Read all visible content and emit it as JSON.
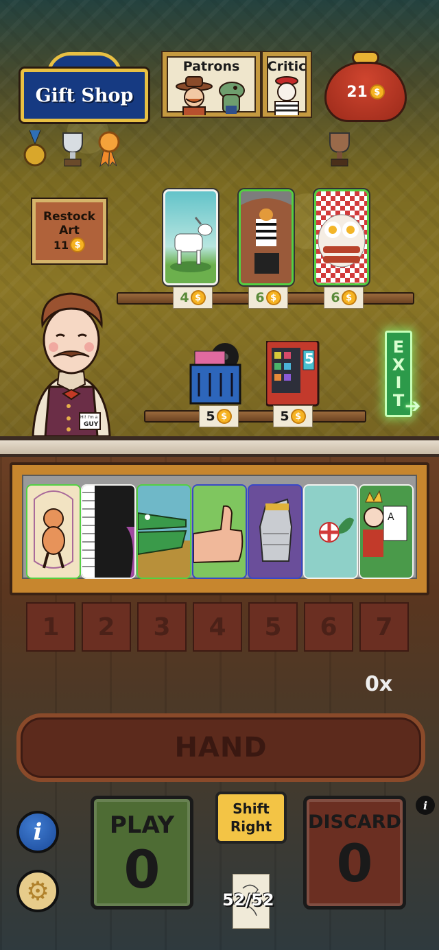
{
  "shop": {
    "sign": "Gift Shop",
    "patrons_label": "Patrons",
    "critic_label": "Critic",
    "coins": "21",
    "restock": {
      "line1": "Restock",
      "line2": "Art",
      "cost": "11"
    }
  },
  "awards": [
    "gold-medal",
    "silver-trophy",
    "orange-ribbon",
    "bronze-trophy"
  ],
  "art_shelf": [
    {
      "name": "goat-art",
      "price": "4",
      "border": "white"
    },
    {
      "name": "striped-dog-art",
      "price": "6",
      "border": "green"
    },
    {
      "name": "eggs-bacon-art",
      "price": "6",
      "border": "green"
    }
  ],
  "item_shelf": [
    {
      "name": "record-crate",
      "price": "5"
    },
    {
      "name": "vending-machine",
      "price": "5",
      "display": "5"
    }
  ],
  "exit": {
    "letters": [
      "E",
      "X",
      "I",
      "T"
    ]
  },
  "shopkeeper": {
    "badge_line1": "Hi! I'm a",
    "badge_line2": "GUY"
  },
  "hand_cards": [
    {
      "name": "jump-rope-cat",
      "border": "green"
    },
    {
      "name": "piano-keys",
      "border": "white"
    },
    {
      "name": "crocodile",
      "border": "green"
    },
    {
      "name": "thumbs-up",
      "border": "blue"
    },
    {
      "name": "armored-gauntlet",
      "border": "blue"
    },
    {
      "name": "peppermint",
      "border": "white"
    },
    {
      "name": "king-cards",
      "border": "white"
    }
  ],
  "slots": [
    "1",
    "2",
    "3",
    "4",
    "5",
    "6",
    "7"
  ],
  "multiplier": "0x",
  "hand_label": "HAND",
  "buttons": {
    "play": "PLAY",
    "play_count": "0",
    "shift_line1": "Shift",
    "shift_line2": "Right",
    "discard": "DISCARD",
    "discard_count": "0"
  },
  "deck": {
    "count": "52/52"
  }
}
